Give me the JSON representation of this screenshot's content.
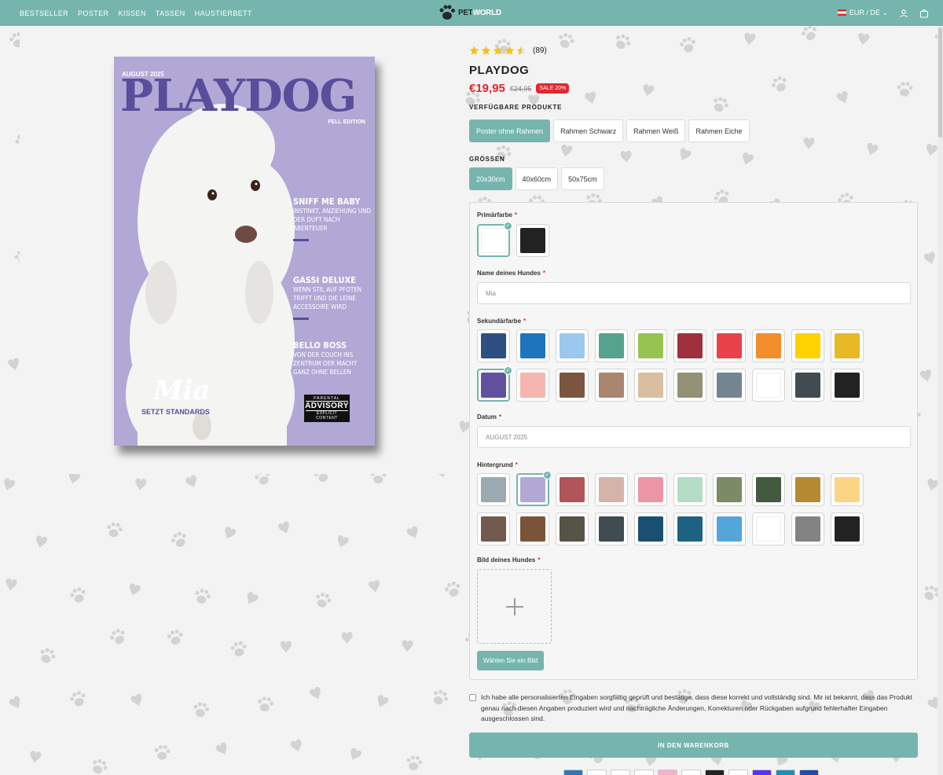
{
  "nav": [
    "BESTSELLER",
    "POSTER",
    "KISSEN",
    "TASSEN",
    "HAUSTIERBETT"
  ],
  "logo": {
    "pet": "PET",
    "world": "WORLD"
  },
  "region": "EUR / DE",
  "rating": {
    "stars": 4.5,
    "count": "(89)"
  },
  "product": {
    "title": "PLAYDOG",
    "price": "€19,95",
    "old_price": "€24,95",
    "sale_badge": "SALE 20%"
  },
  "poster": {
    "issue": "AUGUST 2025",
    "masthead": "PLAYDOG",
    "edition": "FELL EDITION",
    "teasers": [
      {
        "head": "SNIFF ME BABY",
        "sub": "INSTINKT, ANZIEHUNG UND DER DUFT NACH ABENTEUER"
      },
      {
        "head": "GASSI DELUXE",
        "sub": "WENN STIL AUF PFOTEN TRIFFT UND DIE LEINE ACCESSOIRE WIRD"
      },
      {
        "head": "BELLO BOSS",
        "sub": "VON DER COUCH INS ZENTRUM DER MACHT GANZ OHNE BELLEN"
      }
    ],
    "dog_name": "Mia",
    "tagline": "SETZT STANDARDS",
    "advisory": {
      "top": "PARENTAL",
      "main": "ADVISORY",
      "bottom": "EXPLICIT CONTENT"
    }
  },
  "products_label": "VERFÜGBARE PRODUKTE",
  "products": [
    "Poster ohne Rahmen",
    "Rahmen Schwarz",
    "Rahmen Weiß",
    "Rahmen Eiche"
  ],
  "products_selected": 0,
  "sizes_label": "GRÖSSEN",
  "sizes": [
    "20x30cm",
    "40x60cm",
    "50x75cm"
  ],
  "sizes_selected": 0,
  "form": {
    "primary_label": "Primärfarbe",
    "primary_colors": [
      "#ffffff",
      "#222222"
    ],
    "primary_selected": 0,
    "name_label": "Name deines Hundes",
    "name_value": "Mia",
    "secondary_label": "Sekundärfarbe",
    "secondary_colors": [
      "#2d4f82",
      "#1f75bd",
      "#9ac8ee",
      "#55a28d",
      "#97c451",
      "#9e313d",
      "#e8414a",
      "#f28e2b",
      "#fdd200",
      "#e8b825",
      "#6351a0",
      "#f4b6ae",
      "#7a5641",
      "#a88670",
      "#d9bea2",
      "#939176",
      "#738590",
      "#ffffff",
      "#434b52",
      "#222222"
    ],
    "secondary_selected": 10,
    "date_label": "Datum",
    "date_value": "AUGUST 2025",
    "background_label": "Hintergrund",
    "background_colors": [
      "#9aaab0",
      "#b2a8d6",
      "#b0555a",
      "#d4b3a8",
      "#ec95a7",
      "#b5dcc7",
      "#7b8a67",
      "#445a3f",
      "#b48a32",
      "#fbd583",
      "#725a4f",
      "#7a5438",
      "#555446",
      "#414b52",
      "#1b4f71",
      "#1d6280",
      "#54a6da",
      "#ffffff",
      "#838383",
      "#222222"
    ],
    "background_selected": 1,
    "image_label": "Bild deines Hundes",
    "upload_button": "Wählen Sie ein Bild",
    "required_mark": "*"
  },
  "confirm_text": "Ich habe alle personalisierten Eingaben sorgfältig geprüft und bestätige, dass diese korrekt und vollständig sind. Mir ist bekannt, dass das Produkt genau nach diesen Angaben produziert wird und nachträgliche Änderungen, Korrekturen oder Rückgaben aufgrund fehlerhafter Eingaben ausgeschlossen sind.",
  "cart_button": "IN DEN WARENKORB",
  "payment_colors": [
    "#2e77bc",
    "#ffffff",
    "#ffffff",
    "#ffffff",
    "#f7b0cc",
    "#ffffff",
    "#222222",
    "#ffffff",
    "#5a31f4",
    "#1d8fbd",
    "#1a4fa3"
  ]
}
